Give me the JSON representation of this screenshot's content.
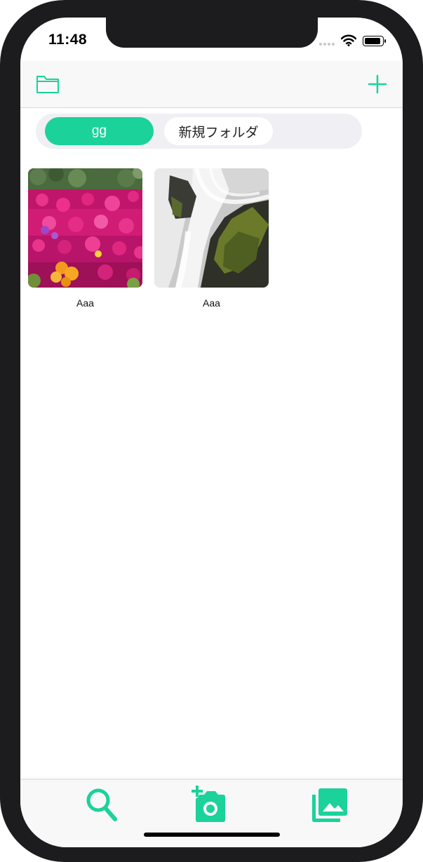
{
  "status_bar": {
    "time": "11:48"
  },
  "nav": {
    "left_icon": "folder-icon",
    "right_icon": "plus-icon"
  },
  "folders": [
    {
      "label": "gg",
      "selected": true
    },
    {
      "label": "新規フォルダ",
      "selected": false
    }
  ],
  "photos": [
    {
      "caption": "Aaa",
      "content": "magenta-flowers"
    },
    {
      "caption": "Aaa",
      "content": "waterfall"
    }
  ],
  "tabbar": {
    "items": [
      {
        "icon": "search-icon"
      },
      {
        "icon": "add-photo-camera-icon"
      },
      {
        "icon": "photo-library-icon"
      }
    ]
  },
  "colors": {
    "accent": "#1bd29b",
    "segment_bg": "#efeff4",
    "bar_bg": "#f8f8f8"
  }
}
